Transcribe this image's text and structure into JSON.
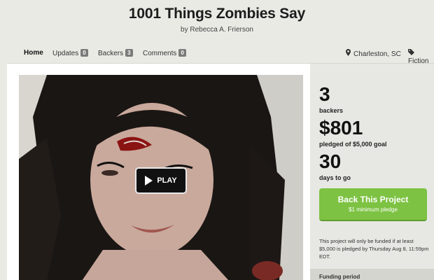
{
  "project": {
    "title": "1001 Things Zombies Say",
    "byline": "by Rebecca A. Frierson"
  },
  "nav": {
    "home": "Home",
    "updates": "Updates",
    "updates_count": "0",
    "backers": "Backers",
    "backers_count": "3",
    "comments": "Comments",
    "comments_count": "0",
    "location": "Charleston, SC",
    "category": "Fiction"
  },
  "video": {
    "play_label": "PLAY"
  },
  "stats": {
    "backers_num": "3",
    "backers_label": "backers",
    "pledged_num": "$801",
    "pledged_label": "pledged of $5,000 goal",
    "days_num": "30",
    "days_label": "days to go"
  },
  "cta": {
    "label": "Back This Project",
    "sub": "$1 minimum pledge"
  },
  "note": "This project will only be funded if at least $5,000 is pledged by Thursday Aug 8, 11:59pm EDT.",
  "funding_period_label": "Funding period",
  "colors": {
    "accent_green": "#7dc243",
    "background": "#e9eae4"
  }
}
